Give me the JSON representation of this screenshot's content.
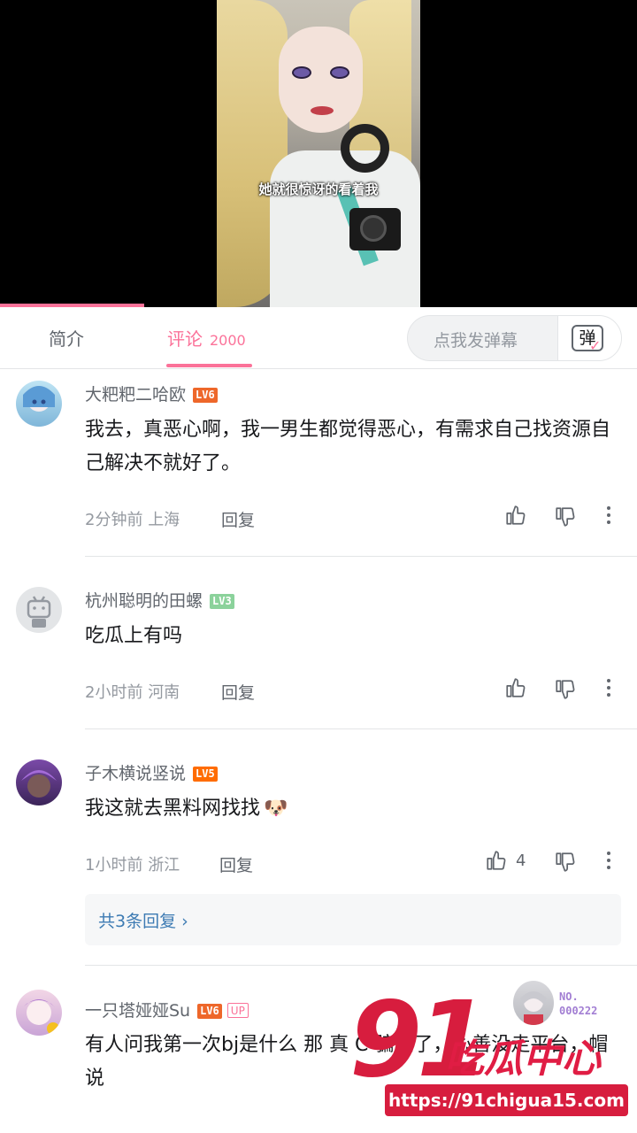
{
  "video": {
    "subtitle": "她就很惊讶的看着我",
    "progress": 0.226
  },
  "tabs": {
    "intro": "简介",
    "comments": "评论",
    "comments_count": "2000",
    "danmaku_placeholder": "点我发弹幕",
    "danmaku_icon_text": "弹"
  },
  "comments": [
    {
      "username": "大粑粑二哈欧",
      "level": "LV6",
      "text": "我去，真恶心啊，我一男生都觉得恶心，有需求自己找资源自己解决不就好了。",
      "time": "2分钟前",
      "location": "上海",
      "reply_label": "回复"
    },
    {
      "username": "杭州聪明的田螺",
      "level": "LV3",
      "text": "吃瓜上有吗",
      "time": "2小时前",
      "location": "河南",
      "reply_label": "回复"
    },
    {
      "username": "子木横说竖说",
      "level": "LV5",
      "text": "我这就去黑料网找找",
      "emoji": "🐶",
      "time": "1小时前",
      "location": "浙江",
      "reply_label": "回复",
      "likes": "4",
      "replies_link": "共3条回复 ›"
    },
    {
      "username": "一只塔娅娅Su",
      "level": "LV6",
      "badge": "UP",
      "text": "有人问我第一次bj是什么 那 真 C 骗走了，心善没走平台，帽 说"
    }
  ],
  "watermark": {
    "number": "91",
    "brand": "吃瓜中心",
    "url": "https://91chigua15.com",
    "fan_no_label": "NO.",
    "fan_no": "000222"
  },
  "colors": {
    "accent": "#fb7299",
    "link": "#3d7bb3",
    "watermark": "#d71d3e"
  }
}
